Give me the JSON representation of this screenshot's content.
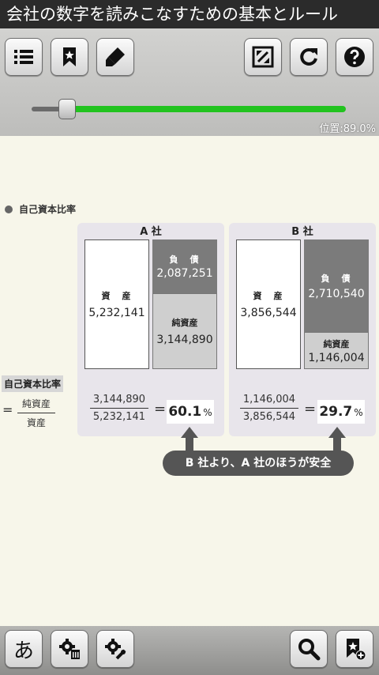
{
  "title": "会社の数字を読みこなすための基本とルール",
  "toolbar": {
    "left_buttons": [
      "list-icon",
      "bookmark-star-icon",
      "marker-icon"
    ],
    "right_buttons": [
      "fit-page-icon",
      "rotate-icon",
      "help-icon"
    ]
  },
  "slider": {
    "position_label": "位置:89.0%",
    "value_percent": 89.0
  },
  "content": {
    "section_title": "自己資本比率",
    "formula": {
      "label": "自己資本比率",
      "equals": "=",
      "numerator": "純資産",
      "denominator": "資産"
    },
    "company_a": {
      "name": "A 社",
      "assets_label": "資　産",
      "assets_value": "5,232,141",
      "liabilities_label": "負　債",
      "liabilities_value": "2,087,251",
      "equity_label": "純資産",
      "equity_value": "3,144,890",
      "numerator": "3,144,890",
      "denominator": "5,232,141",
      "equals": "=",
      "ratio": "60.1",
      "ratio_unit": "%"
    },
    "company_b": {
      "name": "B 社",
      "assets_label": "資　産",
      "assets_value": "3,856,544",
      "liabilities_label": "負　債",
      "liabilities_value": "2,710,540",
      "equity_label": "純資産",
      "equity_value": "1,146,004",
      "numerator": "1,146,004",
      "denominator": "3,856,544",
      "equals": "=",
      "ratio": "29.7",
      "ratio_unit": "%"
    },
    "callout": "B 社より、A 社のほうが安全"
  },
  "bottom": {
    "font_button_label": "あ",
    "left_buttons": [
      "font-icon",
      "settings-page-icon",
      "settings-tools-icon"
    ],
    "right_buttons": [
      "search-icon",
      "add-bookmark-icon"
    ]
  }
}
